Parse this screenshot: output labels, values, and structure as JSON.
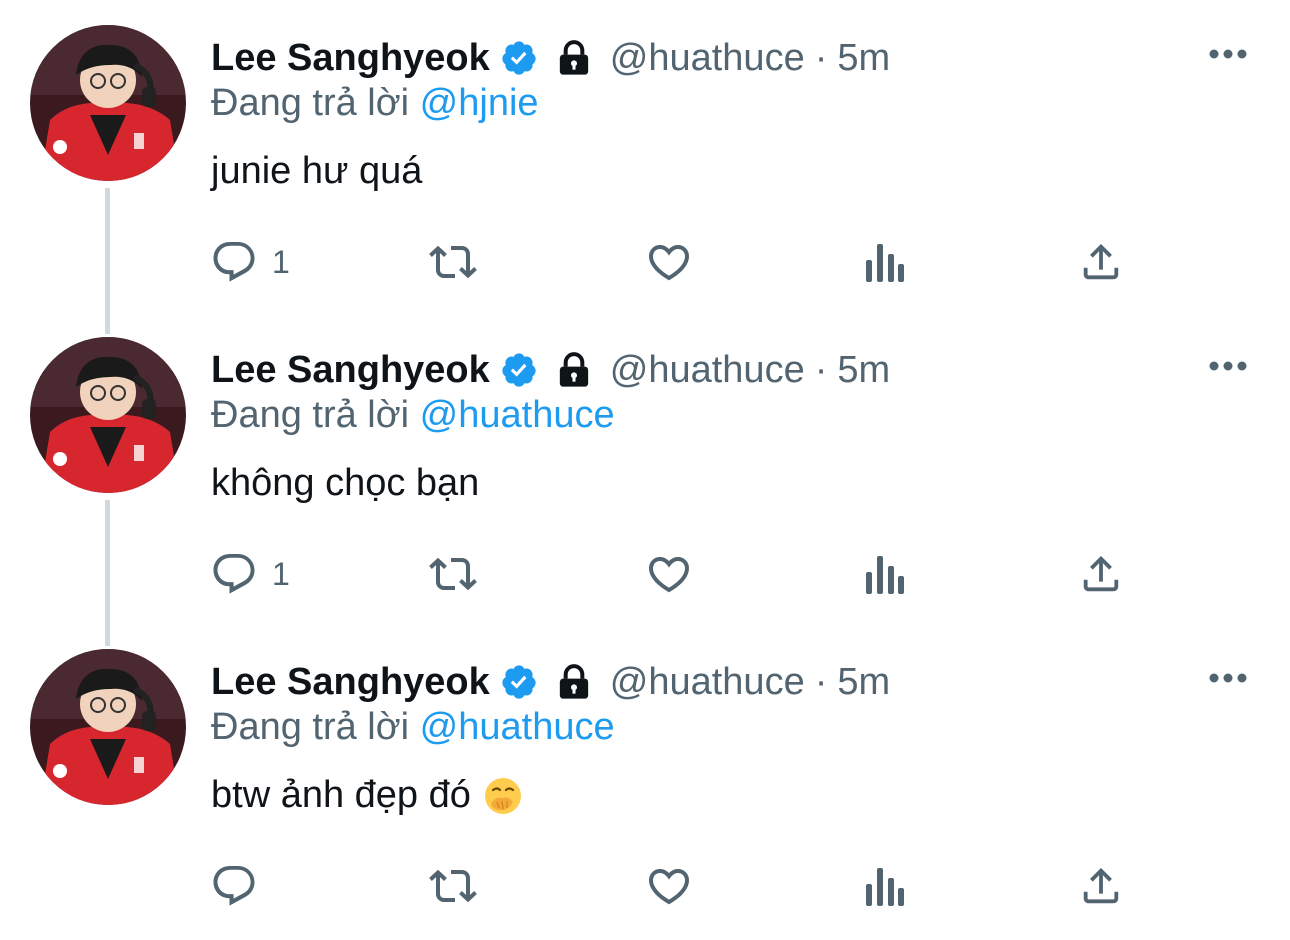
{
  "colors": {
    "accent": "#1d9bf0",
    "secondary_text": "#536471",
    "primary_text": "#0f1419",
    "thread_line": "#cfd9de"
  },
  "tweets": [
    {
      "author_name": "Lee Sanghyeok",
      "verified_icon": "verified-badge-icon",
      "lock_icon": "lock-icon",
      "handle": "@huathuce",
      "separator": "·",
      "time": "5m",
      "reply_prefix": "Đang trả lời",
      "reply_to": "@hjnie",
      "text": "junie hư quá",
      "emoji": "",
      "reply_count": "1"
    },
    {
      "author_name": "Lee Sanghyeok",
      "verified_icon": "verified-badge-icon",
      "lock_icon": "lock-icon",
      "handle": "@huathuce",
      "separator": "·",
      "time": "5m",
      "reply_prefix": "Đang trả lời",
      "reply_to": "@huathuce",
      "text": "không chọc bạn",
      "emoji": "",
      "reply_count": "1"
    },
    {
      "author_name": "Lee Sanghyeok",
      "verified_icon": "verified-badge-icon",
      "lock_icon": "lock-icon",
      "handle": "@huathuce",
      "separator": "·",
      "time": "5m",
      "reply_prefix": "Đang trả lời",
      "reply_to": "@huathuce",
      "text": "btw ảnh đẹp đó",
      "emoji": "face-with-hand-over-mouth-emoji",
      "reply_count": ""
    }
  ],
  "action_icons": [
    "reply-icon",
    "retweet-icon",
    "like-icon",
    "analytics-icon",
    "share-icon"
  ],
  "more_icon": "more-dots-icon"
}
